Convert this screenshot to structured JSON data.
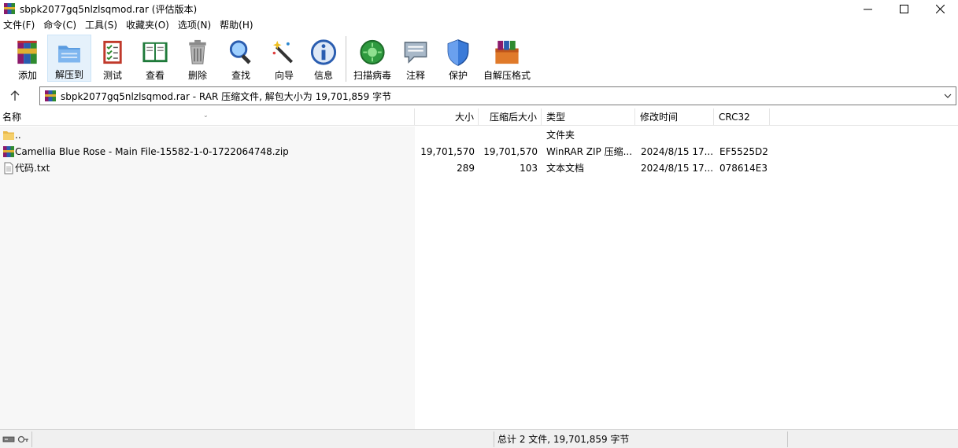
{
  "window": {
    "title": "sbpk2077gq5nlzlsqmod.rar (评估版本)",
    "controls": [
      "minimize",
      "maximize",
      "close"
    ]
  },
  "menu": [
    {
      "label": "文件(F)"
    },
    {
      "label": "命令(C)"
    },
    {
      "label": "工具(S)"
    },
    {
      "label": "收藏夹(O)"
    },
    {
      "label": "选项(N)"
    },
    {
      "label": "帮助(H)"
    }
  ],
  "toolbar": [
    {
      "label": "添加",
      "icon": "add-archive-icon"
    },
    {
      "label": "解压到",
      "icon": "extract-folder-icon",
      "active": true
    },
    {
      "label": "测试",
      "icon": "test-checklist-icon"
    },
    {
      "label": "查看",
      "icon": "view-book-icon"
    },
    {
      "label": "删除",
      "icon": "trash-icon"
    },
    {
      "label": "查找",
      "icon": "magnifier-icon"
    },
    {
      "label": "向导",
      "icon": "wizard-wand-icon"
    },
    {
      "label": "信息",
      "icon": "info-icon"
    },
    {
      "label": "扫描病毒",
      "icon": "virus-scan-icon"
    },
    {
      "label": "注释",
      "icon": "comment-icon"
    },
    {
      "label": "保护",
      "icon": "shield-icon"
    },
    {
      "label": "自解压格式",
      "icon": "sfx-archive-icon"
    }
  ],
  "address": {
    "text": "sbpk2077gq5nlzlsqmod.rar - RAR 压缩文件, 解包大小为 19,701,859 字节"
  },
  "columns": {
    "name": "名称",
    "size": "大小",
    "packed": "压缩后大小",
    "type": "类型",
    "modified": "修改时间",
    "crc": "CRC32"
  },
  "files": [
    {
      "name": "..",
      "size": "",
      "packed": "",
      "type": "文件夹",
      "modified": "",
      "crc": "",
      "icon": "folder-icon"
    },
    {
      "name": "Camellia Blue Rose - Main File-15582-1-0-1722064748.zip",
      "size": "19,701,570",
      "packed": "19,701,570",
      "type": "WinRAR ZIP 压缩...",
      "modified": "2024/8/15 17...",
      "crc": "EF5525D2",
      "icon": "zip-archive-icon"
    },
    {
      "name": "代码.txt",
      "size": "289",
      "packed": "103",
      "type": "文本文档",
      "modified": "2024/8/15 17...",
      "crc": "078614E3",
      "icon": "text-file-icon"
    }
  ],
  "status": {
    "text": "总计 2 文件, 19,701,859 字节"
  }
}
